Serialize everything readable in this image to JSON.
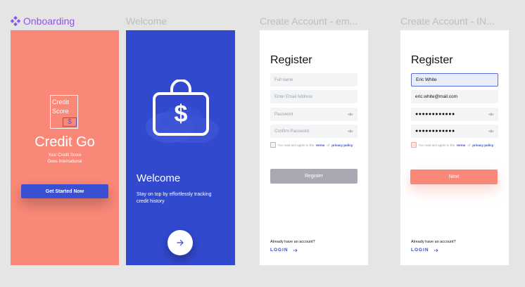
{
  "frames": {
    "onboarding": {
      "label": "Onboarding",
      "logo_line1": "Credit",
      "logo_line2": "Score",
      "logo_symbol": "$",
      "brand": "Credit Go",
      "tagline_line1": "Your Credit Score",
      "tagline_line2": "Goes International",
      "button": "Get Started Now"
    },
    "welcome": {
      "label": "Welcome",
      "title": "Welcome",
      "text": "Stay on top by effortlessly tracking credit history"
    },
    "create_email": {
      "label": "Create Account - em...",
      "title": "Register",
      "fields": {
        "full_name": "Full name",
        "email": "Enter Email Address",
        "password": "Password",
        "confirm": "Confirm Password"
      },
      "agree_prefix": "I've read and agree to the",
      "terms": "terms",
      "of": "of",
      "privacy": "privacy policy",
      "button": "Register",
      "already": "Already have an account?",
      "login": "LOGIN"
    },
    "create_info": {
      "label": "Create Account - IN...",
      "title": "Register",
      "fields": {
        "full_name": "Eric White",
        "email": "eric.white@mail.com",
        "password": "●●●●●●●●●●●●",
        "confirm": "●●●●●●●●●●●●"
      },
      "agree_prefix": "I've read and agree to the",
      "terms": "terms",
      "of": "of",
      "privacy": "privacy policy",
      "button": "Next",
      "already": "Already have an account?",
      "login": "LOGIN"
    }
  },
  "colors": {
    "coral": "#fa8878",
    "blue": "#3149cf",
    "purple_label": "#8b57e0",
    "disabled_button": "#a8a9b2",
    "canvas": "#e5e5e5"
  },
  "icons": [
    "component-icon",
    "money-bag-icon",
    "arrow-right-icon",
    "eye-icon"
  ]
}
